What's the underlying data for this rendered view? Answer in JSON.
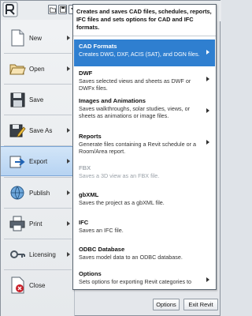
{
  "quick_access": {
    "open_icon": "folder-open-icon",
    "save_icon": "save-icon",
    "dropdown_icon": "dropdown-icon"
  },
  "menu": {
    "items": [
      {
        "label": "New",
        "icon": "new-document-icon"
      },
      {
        "label": "Open",
        "icon": "open-folder-icon"
      },
      {
        "label": "Save",
        "icon": "floppy-disk-icon"
      },
      {
        "label": "Save As",
        "icon": "save-as-icon"
      },
      {
        "label": "Export",
        "icon": "export-icon"
      },
      {
        "label": "Publish",
        "icon": "publish-icon"
      },
      {
        "label": "Print",
        "icon": "printer-icon"
      },
      {
        "label": "Licensing",
        "icon": "licensing-icon"
      },
      {
        "label": "Close",
        "icon": "close-document-icon"
      }
    ]
  },
  "flyout": {
    "header": "Creates and saves CAD files, schedules, reports, IFC files and sets options for CAD and IFC formats.",
    "items": [
      {
        "title": "CAD Formats",
        "description": "Creates DWG, DXF, ACIS (SAT), and DGN files."
      },
      {
        "title": "DWF",
        "description": "Saves selected views and sheets as DWF or DWFx files."
      },
      {
        "title": "Images and Animations",
        "description": "Saves walkthroughs, solar studies, views, or sheets as animations or image files."
      },
      {
        "title": "Reports",
        "description": "Generate files containing a Revit schedule or a Room/Area report."
      },
      {
        "title": "FBX",
        "description": "Saves a 3D view as an FBX file."
      },
      {
        "title": "gbXML",
        "description": "Saves the project as a gbXML file."
      },
      {
        "title": "IFC",
        "description": "Saves an IFC file."
      },
      {
        "title": "ODBC Database",
        "description": "Saves model data to an ODBC database."
      },
      {
        "title": "Options",
        "description": "Sets options for exporting Revit categories to"
      }
    ]
  },
  "buttons": {
    "options": "Options",
    "exit": "Exit Revit"
  },
  "colors": {
    "highlight": "#2f7fd0",
    "active_menu": "#b6d3f2",
    "revit_red": "#c8202a"
  }
}
